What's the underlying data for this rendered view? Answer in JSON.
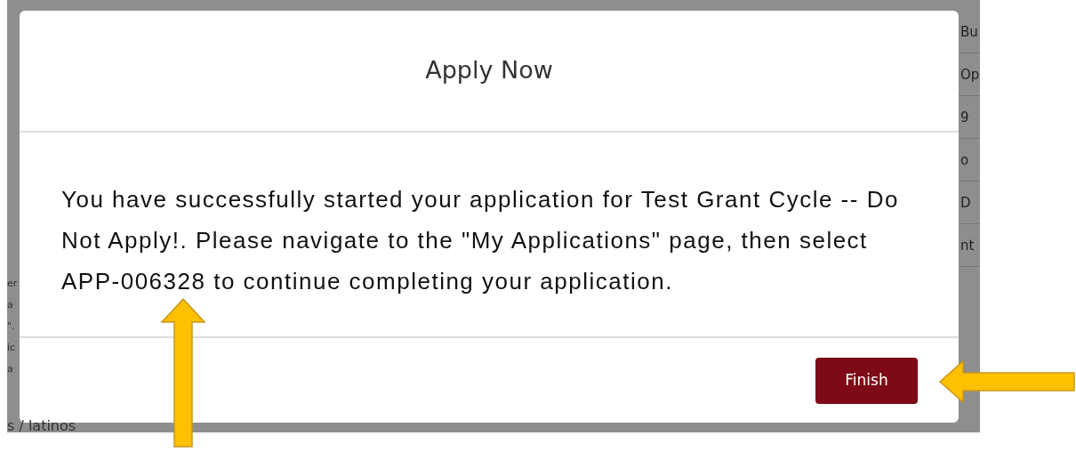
{
  "background": {
    "left_fragments": [
      "er",
      "a",
      "\".",
      "ic",
      "a"
    ],
    "right_fragments": [
      "Bu",
      "Op",
      "9",
      "o",
      "D",
      "nt"
    ],
    "bottom_fragment": "s / latinos"
  },
  "dialog": {
    "title": "Apply Now",
    "message": "You have successfully started your application for Test Grant Cycle -- Do Not Apply!. Please navigate to the \"My Applications\" page, then select APP-006328 to continue completing your application.",
    "buttons": [
      "Finish"
    ]
  }
}
